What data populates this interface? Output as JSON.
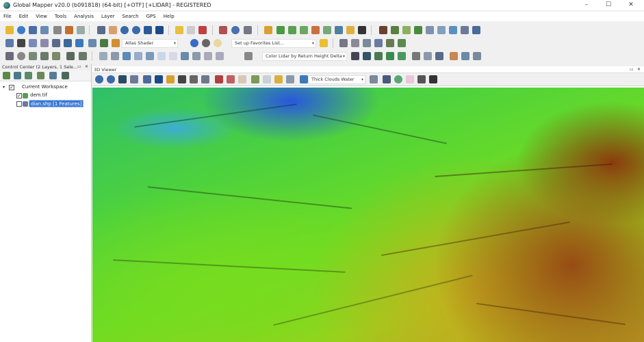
{
  "window": {
    "title": "Global Mapper v20.0 (b091818) (64-bit) [+OTF] [+LIDAR] - REGISTERED",
    "minimize": "–",
    "maximize": "☐",
    "close": "✕"
  },
  "menu": [
    "File",
    "Edit",
    "View",
    "Tools",
    "Analysis",
    "Layer",
    "Search",
    "GPS",
    "Help"
  ],
  "toolbar": {
    "shader_select": "Atlas Shader",
    "favorites_select": "Set up Favorites List...",
    "lidar_color_select": "Color Lidar by Return Height Delta"
  },
  "control_center": {
    "title": "Control Center (2 Layers, 1 Sele...",
    "workspace": "Current Workspace",
    "layers": [
      {
        "name": "dem.tif",
        "checked": true
      },
      {
        "name": "dian.shp [1 Features]",
        "checked": false,
        "selected": true
      }
    ],
    "check_mark": "✓"
  },
  "viewer": {
    "title": "3D Viewer",
    "water_select": "Thick Clouds Water"
  },
  "colors": {
    "selection": "#3a78d6",
    "terrain_low": "#2a5ee8",
    "terrain_mid": "#4fd63a",
    "terrain_high": "#a0401a"
  }
}
